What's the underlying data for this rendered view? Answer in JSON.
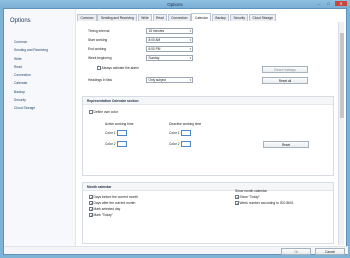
{
  "window": {
    "title": "Options",
    "controls": [
      "–",
      "□",
      "✕"
    ]
  },
  "sidebar": {
    "title": "Options",
    "items": [
      "Common",
      "Sending and Receiving",
      "Write",
      "Read",
      "Connection",
      "Calendar",
      "Backup",
      "Security",
      "Cloud Storage"
    ]
  },
  "tabs": [
    "Common",
    "Sending and Receiving",
    "Write",
    "Read",
    "Connection",
    "Calendar",
    "Backup",
    "Security",
    "Cloud Storage"
  ],
  "active_tab": "Calendar",
  "general": {
    "timing_interval_label": "Timing interval",
    "timing_interval_value": "15 minutes",
    "start_working_label": "Start working",
    "start_working_value": "8:00 AM",
    "end_working_label": "End working",
    "end_working_value": "6:00 PM",
    "week_beginning_label": "Week beginning",
    "week_beginning_value": "Sunday",
    "always_activate_label": "Always activate the alarm",
    "reset_holidays_label": "Reset Holidays",
    "headings_label": "Headings in lists",
    "headings_value": "Only subject",
    "reset_all_label": "Reset all"
  },
  "representation": {
    "title": "Representation Calendar section",
    "define_own_color_label": "Define own color",
    "active_label": "Active working time",
    "deactive_label": "Deactive working time",
    "color1_label": "Color 1",
    "color2_label": "Color 2",
    "reset_label": "Reset"
  },
  "month_calendar": {
    "title": "Month calendar",
    "checks_left": [
      {
        "label": "Days before the current month",
        "checked": true
      },
      {
        "label": "Days after the current month",
        "checked": true
      },
      {
        "label": "Mark selected day",
        "checked": true
      },
      {
        "label": "Mark \"Today\"",
        "checked": true
      }
    ],
    "show_month_calendar_label": "Show month calendar",
    "checks_right": [
      {
        "label": "Show \"Today\"",
        "checked": true
      },
      {
        "label": "Week number according to ISO 8601",
        "checked": true
      }
    ]
  },
  "footer": {
    "ok_label": "Ok",
    "cancel_label": "Cancel"
  }
}
